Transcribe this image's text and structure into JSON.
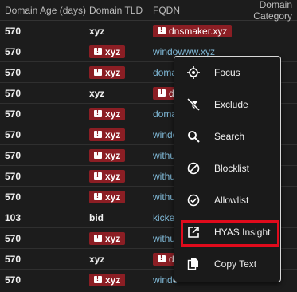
{
  "table": {
    "headers": {
      "age": "Domain Age (days)",
      "tld": "Domain TLD",
      "fqdn": "FQDN",
      "category": "Domain Category"
    },
    "rows": [
      {
        "age": "570",
        "tld": "xyz",
        "tld_flagged": false,
        "fqdn": "dnsmaker.xyz",
        "fqdn_flagged": true
      },
      {
        "age": "570",
        "tld": "xyz",
        "tld_flagged": true,
        "fqdn": "windowww.xyz",
        "fqdn_flagged": false
      },
      {
        "age": "570",
        "tld": "xyz",
        "tld_flagged": true,
        "fqdn": "doma",
        "fqdn_flagged": false
      },
      {
        "age": "570",
        "tld": "xyz",
        "tld_flagged": false,
        "fqdn": "dr",
        "fqdn_flagged": true
      },
      {
        "age": "570",
        "tld": "xyz",
        "tld_flagged": true,
        "fqdn": "doma",
        "fqdn_flagged": false
      },
      {
        "age": "570",
        "tld": "xyz",
        "tld_flagged": true,
        "fqdn": "windo",
        "fqdn_flagged": false
      },
      {
        "age": "570",
        "tld": "xyz",
        "tld_flagged": true,
        "fqdn": "withu",
        "fqdn_flagged": false
      },
      {
        "age": "570",
        "tld": "xyz",
        "tld_flagged": true,
        "fqdn": "withu",
        "fqdn_flagged": false
      },
      {
        "age": "570",
        "tld": "xyz",
        "tld_flagged": true,
        "fqdn": "withu",
        "fqdn_flagged": false
      },
      {
        "age": "103",
        "tld": "bid",
        "tld_flagged": false,
        "fqdn": "kicke",
        "fqdn_flagged": false
      },
      {
        "age": "570",
        "tld": "xyz",
        "tld_flagged": true,
        "fqdn": "withu",
        "fqdn_flagged": false
      },
      {
        "age": "570",
        "tld": "xyz",
        "tld_flagged": false,
        "fqdn": "d",
        "fqdn_flagged": true
      },
      {
        "age": "570",
        "tld": "xyz",
        "tld_flagged": true,
        "fqdn": "windo",
        "fqdn_flagged": false
      }
    ]
  },
  "context_menu": {
    "items": [
      {
        "label": "Focus",
        "icon": "focus-icon"
      },
      {
        "label": "Exclude",
        "icon": "exclude-filter-icon"
      },
      {
        "label": "Search",
        "icon": "search-icon"
      },
      {
        "label": "Blocklist",
        "icon": "blocklist-icon"
      },
      {
        "label": "Allowlist",
        "icon": "allowlist-icon"
      },
      {
        "label": "HYAS Insight",
        "icon": "open-external-icon"
      },
      {
        "label": "Copy Text",
        "icon": "copy-icon"
      }
    ],
    "highlighted": "HYAS Insight"
  },
  "colors": {
    "background": "#1c1c1c",
    "badge": "#8b1e24",
    "link": "#7fb8d6",
    "highlight_box": "#e00b1c"
  }
}
